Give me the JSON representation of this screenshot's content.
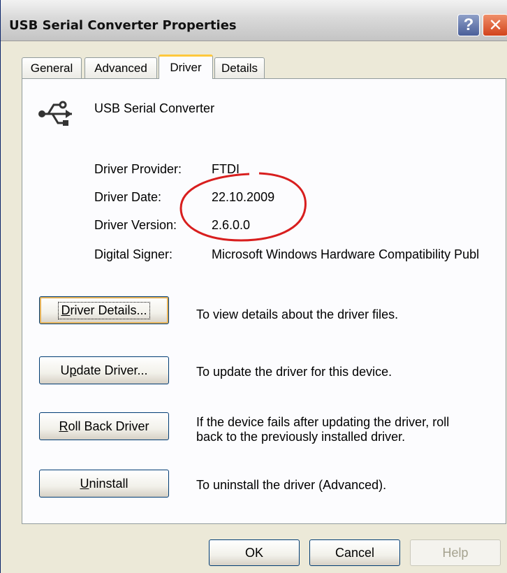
{
  "window": {
    "title": "USB Serial Converter Properties",
    "help_glyph": "?",
    "close_glyph": "✕"
  },
  "tabs": [
    {
      "label": "General",
      "active": false
    },
    {
      "label": "Advanced",
      "active": false
    },
    {
      "label": "Driver",
      "active": true
    },
    {
      "label": "Details",
      "active": false
    }
  ],
  "device": {
    "name": "USB Serial Converter",
    "icon": "usb-icon"
  },
  "info": [
    {
      "label": "Driver Provider:",
      "value": "FTDI"
    },
    {
      "label": "Driver Date:",
      "value": "22.10.2009"
    },
    {
      "label": "Driver Version:",
      "value": "2.6.0.0"
    },
    {
      "label": "Digital Signer:",
      "value": "Microsoft Windows Hardware Compatibility Publ"
    }
  ],
  "actions": [
    {
      "mnemonic": "D",
      "rest": "river Details...",
      "description_line1": "To view details about the driver files.",
      "description_line2": ""
    },
    {
      "pre": "U",
      "mnemonic": "p",
      "rest": "date Driver...",
      "description_line1": "To update the driver for this device.",
      "description_line2": ""
    },
    {
      "mnemonic": "R",
      "rest": "oll Back Driver",
      "description_line1": "If the device fails after updating the driver, roll",
      "description_line2": "back to the previously installed driver."
    },
    {
      "mnemonic": "U",
      "rest": "ninstall",
      "description_line1": "To uninstall the driver (Advanced).",
      "description_line2": ""
    }
  ],
  "footer": {
    "ok": "OK",
    "cancel": "Cancel",
    "help": "Help"
  },
  "colors": {
    "annotation_circle": "#d81e1e",
    "active_tab_accent": "#ffc83c"
  }
}
